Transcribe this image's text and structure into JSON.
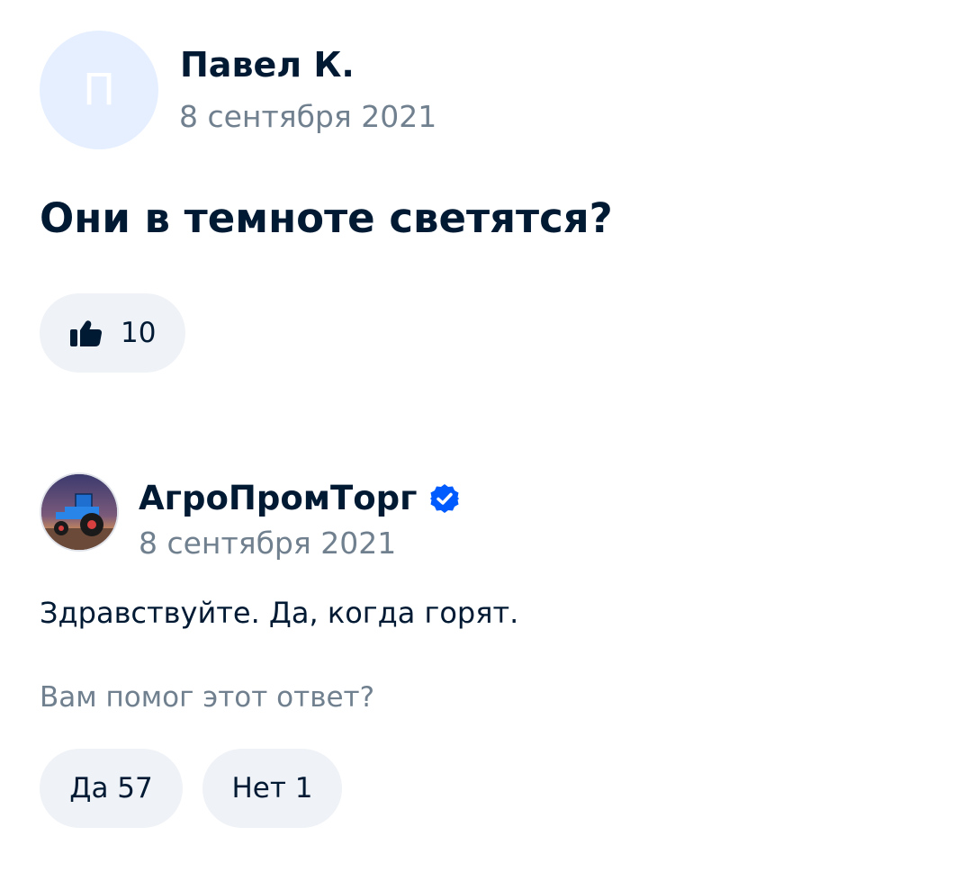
{
  "question": {
    "author_initial": "П",
    "author_name": "Павел К.",
    "date": "8 сентября 2021",
    "text": "Они в темноте светятся?",
    "likes": "10",
    "like_icon": "thumbs-up-icon"
  },
  "answer": {
    "author_name": "АгроПромТорг",
    "verified_icon": "verified-check-icon",
    "avatar_image": "tractor-photo",
    "date": "8 сентября 2021",
    "text": "Здравствуйте. Да, когда горят.",
    "helpful_prompt": "Вам помог этот ответ?",
    "yes_label": "Да 57",
    "no_label": "Нет 1"
  },
  "colors": {
    "text_primary": "#001a34",
    "text_secondary": "#70808f",
    "button_bg": "#eff2f6",
    "avatar_bg": "#e5efff",
    "verified": "#005bff"
  }
}
